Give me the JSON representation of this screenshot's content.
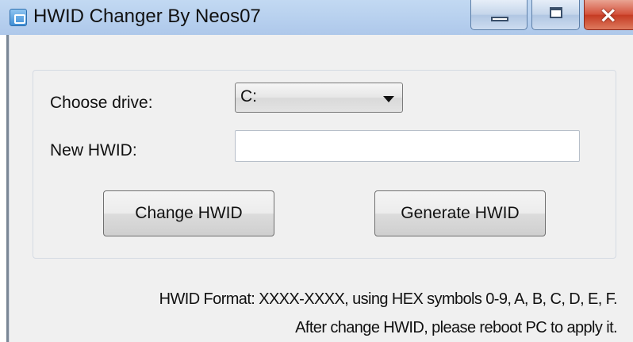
{
  "window": {
    "title": "HWID Changer By Neos07",
    "controls": {
      "minimize": "minimize",
      "maximize": "maximize",
      "close": "×"
    }
  },
  "form": {
    "drive_label": "Choose drive:",
    "drive_value": "C:",
    "hwid_label": "New HWID:",
    "hwid_value": "",
    "change_button": "Change HWID",
    "generate_button": "Generate HWID"
  },
  "info": {
    "line1": "HWID Format: XXXX-XXXX, using HEX symbols 0-9, A, B, C, D, E, F.",
    "line2": "After change HWID, please reboot PC to apply it."
  },
  "icons": {
    "app": "app-icon",
    "minimize": "minimize-icon",
    "maximize": "maximize-icon",
    "close": "close-icon",
    "dropdown": "chevron-down-icon"
  },
  "colors": {
    "titlebar": "#b6cfee",
    "close_button": "#c43a22",
    "client_background": "#f0f0f0"
  }
}
